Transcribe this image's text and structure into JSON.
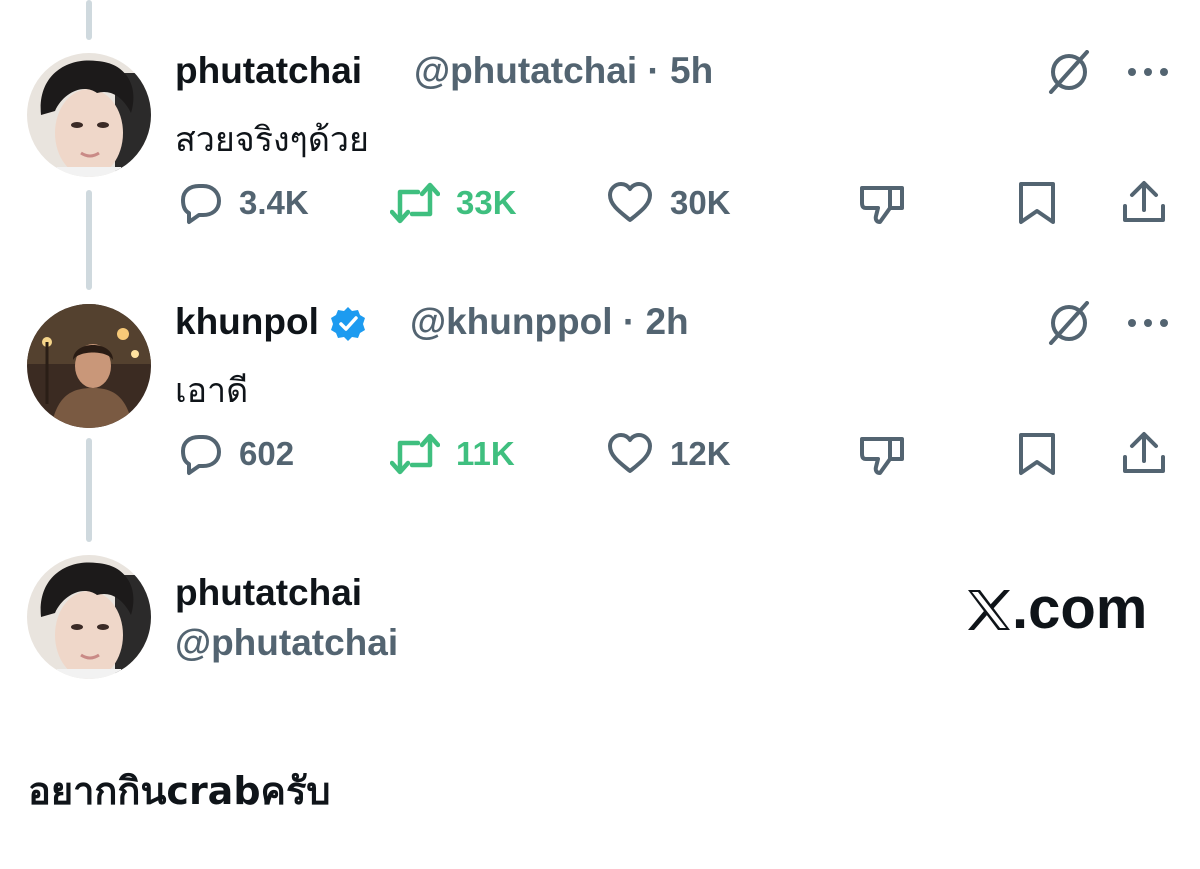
{
  "tweets": [
    {
      "name": "phutatchai",
      "handle": "@phutatchai",
      "time": "5h",
      "text": "สวยจริงๆด้วย",
      "replies": "3.4K",
      "reposts": "33K",
      "likes": "30K",
      "verified": false
    },
    {
      "name": "khunpol",
      "handle": "@khunppol",
      "time": "2h",
      "text": "เอาดี",
      "replies": "602",
      "reposts": "11K",
      "likes": "12K",
      "verified": true
    }
  ],
  "composer": {
    "name": "phutatchai",
    "handle": "@phutatchai",
    "text": "อยากกินcrabครับ"
  },
  "brand": {
    "label": ".com",
    "logo": "x-logo"
  },
  "separator": "·",
  "colors": {
    "text": "#0f1419",
    "muted": "#536471",
    "repost_green": "#3fbf7f",
    "verified_blue": "#1d9bf0",
    "thread_line": "#cfd9de"
  },
  "icons": [
    "reply-icon",
    "repost-icon",
    "like-icon",
    "dislike-icon",
    "bookmark-icon",
    "share-icon",
    "grok-icon",
    "more-icon",
    "verified-badge-icon"
  ]
}
